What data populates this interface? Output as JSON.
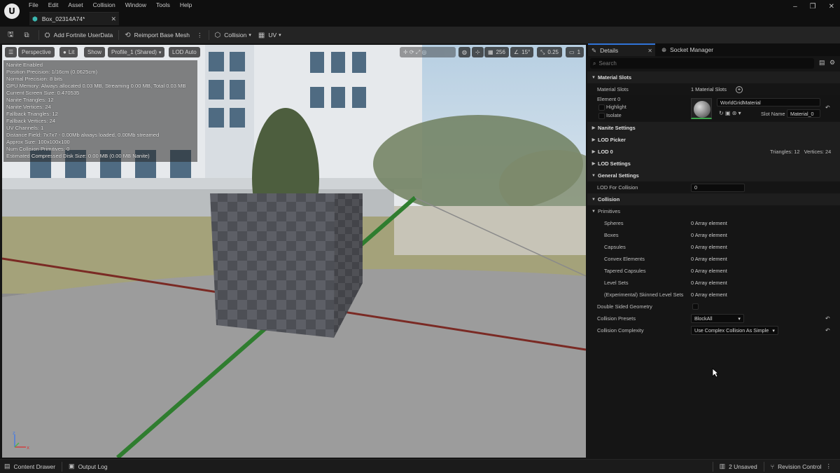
{
  "menu": [
    "File",
    "Edit",
    "Asset",
    "Collision",
    "Window",
    "Tools",
    "Help"
  ],
  "document_tab": {
    "label": "Box_02314A74*"
  },
  "toolbar": {
    "add_userdata": "Add Fortnite UserData",
    "reimport": "Reimport Base Mesh",
    "collision": "Collision",
    "uv": "UV"
  },
  "viewport": {
    "buttons": {
      "perspective": "Perspective",
      "lit": "Lit",
      "show": "Show",
      "profile": "Profile_1 (Shared)",
      "lod": "LOD Auto"
    },
    "right_toolbar": {
      "grid_size": "256",
      "rotation_snap": "15°",
      "scale_snap": "0.25",
      "camera_speed": "1"
    },
    "stats": [
      "Nanite Enabled",
      "Position Precision: 1/16cm (0.0625cm)",
      "Normal Precision: 8 bits",
      "GPU Memory: Always allocated 0.03 MB, Streaming 0.00 MB, Total 0.03 MB",
      "Current Screen Size: 0.470535",
      "Nanite Triangles: 12",
      "Nanite Vertices: 24",
      "Fallback Triangles: 12",
      "Fallback Vertices: 24",
      "UV Channels: 1",
      "Distance Field: 7x7x7 - 0.00Mb always loaded, 0.00Mb streamed",
      "Approx Size: 100x100x100",
      "Num Collision Primitives: 0",
      "Estimated Compressed Disk Size: 0.00 MB (0.00 MB Nanite)"
    ]
  },
  "details": {
    "tabs": {
      "details": "Details",
      "socket_manager": "Socket Manager"
    },
    "search_placeholder": "Search",
    "material_slots": {
      "category": "Material Slots",
      "label": "Material Slots",
      "value": "1 Material Slots",
      "element": "Element 0",
      "highlight": "Highlight",
      "isolate": "Isolate",
      "material_name": "WorldGridMaterial",
      "slot_name_label": "Slot Name",
      "slot_name_value": "Material_0"
    },
    "categories": {
      "nanite": "Nanite Settings",
      "lod_picker": "LOD Picker",
      "lod0": "LOD 0",
      "lod_settings": "LOD Settings",
      "general": "General Settings",
      "collision": "Collision",
      "primitives": "Primitives"
    },
    "lod0_info": "Triangles: 12   Vertices: 24",
    "lod_for_collision": {
      "label": "LOD For Collision",
      "value": "0"
    },
    "primitives": [
      {
        "label": "Spheres",
        "value": "0 Array element"
      },
      {
        "label": "Boxes",
        "value": "0 Array element"
      },
      {
        "label": "Capsules",
        "value": "0 Array element"
      },
      {
        "label": "Convex Elements",
        "value": "0 Array element"
      },
      {
        "label": "Tapered Capsules",
        "value": "0 Array element"
      },
      {
        "label": "Level Sets",
        "value": "0 Array element"
      },
      {
        "label": "(Experimental) Skinned Level Sets",
        "value": "0 Array element"
      }
    ],
    "double_sided": {
      "label": "Double Sided Geometry",
      "checked": false
    },
    "collision_presets": {
      "label": "Collision Presets",
      "value": "BlockAll"
    },
    "collision_complexity": {
      "label": "Collision Complexity",
      "value": "Use Complex Collision As Simple"
    }
  },
  "statusbar": {
    "content_drawer": "Content Drawer",
    "output_log": "Output Log",
    "unsaved": "2 Unsaved",
    "revision_control": "Revision Control"
  }
}
